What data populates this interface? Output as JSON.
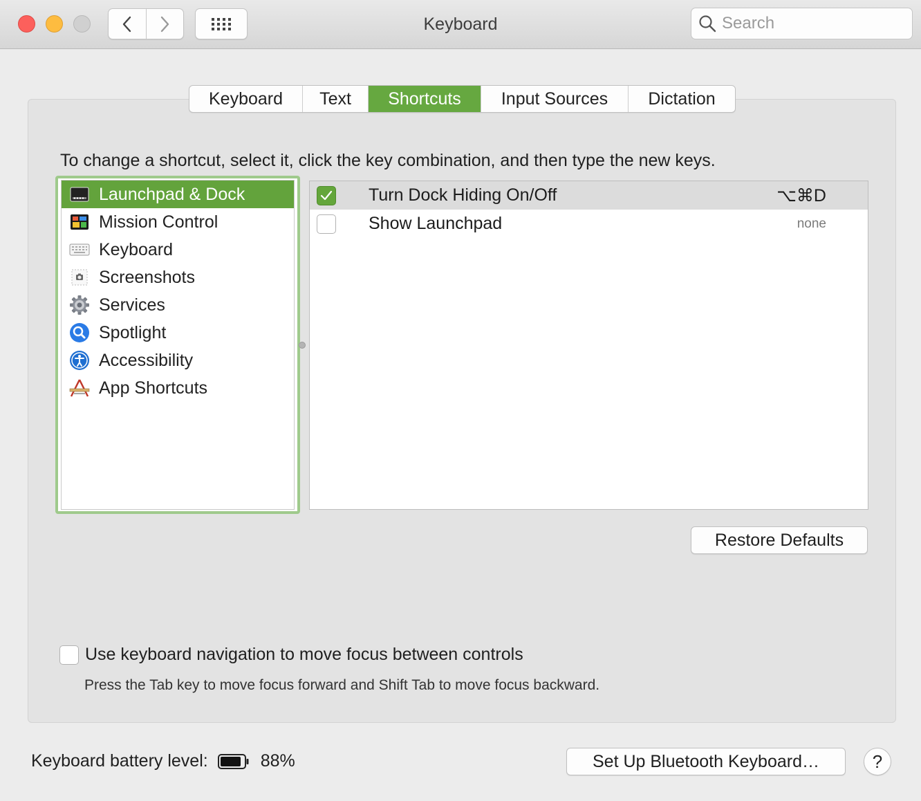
{
  "window": {
    "title": "Keyboard"
  },
  "search": {
    "placeholder": "Search"
  },
  "tabs": [
    {
      "label": "Keyboard",
      "active": false
    },
    {
      "label": "Text",
      "active": false
    },
    {
      "label": "Shortcuts",
      "active": true
    },
    {
      "label": "Input Sources",
      "active": false
    },
    {
      "label": "Dictation",
      "active": false
    }
  ],
  "instructions": "To change a shortcut, select it, click the key combination, and then type the new keys.",
  "categories": [
    {
      "label": "Launchpad & Dock",
      "icon": "launchpad-dock-icon",
      "selected": true
    },
    {
      "label": "Mission Control",
      "icon": "mission-control-icon",
      "selected": false
    },
    {
      "label": "Keyboard",
      "icon": "keyboard-icon",
      "selected": false
    },
    {
      "label": "Screenshots",
      "icon": "screenshots-icon",
      "selected": false
    },
    {
      "label": "Services",
      "icon": "gear-icon",
      "selected": false
    },
    {
      "label": "Spotlight",
      "icon": "spotlight-icon",
      "selected": false
    },
    {
      "label": "Accessibility",
      "icon": "accessibility-icon",
      "selected": false
    },
    {
      "label": "App Shortcuts",
      "icon": "app-shortcuts-icon",
      "selected": false
    }
  ],
  "shortcuts": [
    {
      "label": "Turn Dock Hiding On/Off",
      "key": "⌥⌘D",
      "checked": true,
      "highlighted": true
    },
    {
      "label": "Show Launchpad",
      "key": "none",
      "checked": false,
      "highlighted": false
    }
  ],
  "restore_label": "Restore Defaults",
  "keyboard_navigation": {
    "label": "Use keyboard navigation to move focus between controls",
    "checked": false,
    "hint": "Press the Tab key to move focus forward and Shift Tab to move focus backward."
  },
  "battery": {
    "label": "Keyboard battery level:",
    "value": "88%",
    "level": 0.88
  },
  "bluetooth_label": "Set Up Bluetooth Keyboard…",
  "help_label": "?",
  "colors": {
    "accent": "#66a840",
    "selection": "#63a33c"
  }
}
